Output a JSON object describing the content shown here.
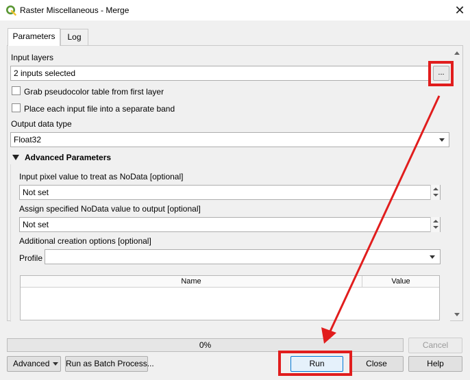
{
  "window": {
    "title": "Raster Miscellaneous - Merge",
    "close_glyph": "✕"
  },
  "tabs": [
    {
      "label": "Parameters",
      "active": true
    },
    {
      "label": "Log",
      "active": false
    }
  ],
  "params": {
    "input_layers_label": "Input layers",
    "input_layers_value": "2 inputs selected",
    "browse_button_label": "...",
    "checkbox_grab_label": "Grab pseudocolor table from first layer",
    "checkbox_grab_checked": false,
    "checkbox_separate_label": "Place each input file into a separate band",
    "checkbox_separate_checked": false,
    "output_type_label": "Output data type",
    "output_type_value": "Float32"
  },
  "advanced": {
    "header": "Advanced Parameters",
    "nodata_input_label": "Input pixel value to treat as NoData [optional]",
    "nodata_input_value": "Not set",
    "nodata_output_label": "Assign specified NoData value to output [optional]",
    "nodata_output_value": "Not set",
    "creation_options_label": "Additional creation options [optional]",
    "profile_label": "Profile",
    "profile_value": "",
    "table_columns": [
      "Name",
      "Value"
    ]
  },
  "progress": {
    "text": "0%",
    "value": 0
  },
  "buttons": {
    "cancel": "Cancel",
    "advanced": "Advanced",
    "batch": "Run as Batch Process...",
    "run": "Run",
    "close": "Close",
    "help": "Help"
  },
  "colors": {
    "highlight": "#e11d1d",
    "qgis_green": "#589632",
    "qgis_yellow": "#f0c330",
    "primary_border": "#0078d7"
  }
}
